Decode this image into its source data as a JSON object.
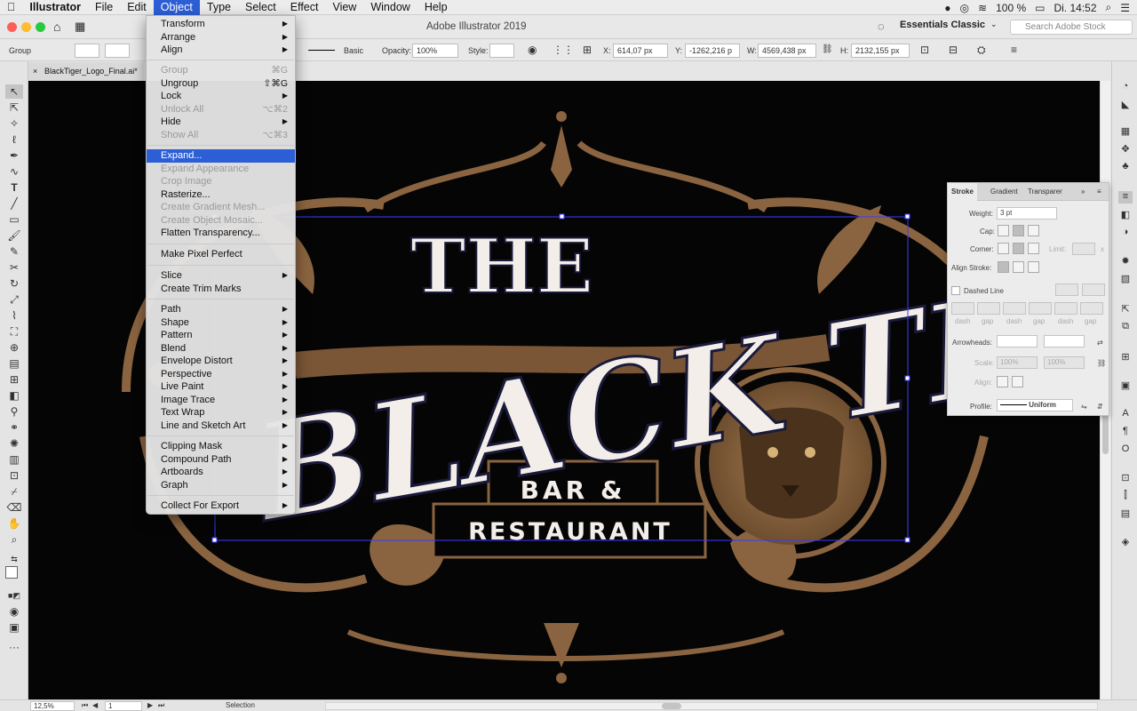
{
  "menubar": {
    "apple": "",
    "app_name": "Illustrator",
    "items": [
      "File",
      "Edit",
      "Object",
      "Type",
      "Select",
      "Effect",
      "View",
      "Window",
      "Help"
    ],
    "active": "Object",
    "right": {
      "battery": "100 %",
      "clock": "Di. 14:52"
    }
  },
  "window": {
    "title": "Adobe Illustrator 2019",
    "workspace": "Essentials Classic",
    "search_placeholder": "Search Adobe Stock",
    "doc_tab": "BlackTiger_Logo_Final.ai* @ 1"
  },
  "control_bar": {
    "selection_type": "Group",
    "stroke_style": "Basic",
    "opacity_label": "Opacity:",
    "opacity_value": "100%",
    "style_label": "Style:",
    "x_label": "X:",
    "x_value": "614,07 px",
    "y_label": "Y:",
    "y_value": "-1262,216 p",
    "w_label": "W:",
    "w_value": "4569,438 px",
    "h_label": "H:",
    "h_value": "2132,155 px"
  },
  "object_menu": {
    "transform": "Transform",
    "arrange": "Arrange",
    "align": "Align",
    "group": "Group",
    "group_sc": "⌘G",
    "ungroup": "Ungroup",
    "ungroup_sc": "⇧⌘G",
    "lock": "Lock",
    "unlock_all": "Unlock All",
    "unlock_sc": "⌥⌘2",
    "hide": "Hide",
    "show_all": "Show All",
    "show_sc": "⌥⌘3",
    "expand": "Expand...",
    "expand_appearance": "Expand Appearance",
    "crop_image": "Crop Image",
    "rasterize": "Rasterize...",
    "gradient_mesh": "Create Gradient Mesh...",
    "object_mosaic": "Create Object Mosaic...",
    "flatten": "Flatten Transparency...",
    "pixel_perfect": "Make Pixel Perfect",
    "slice": "Slice",
    "trim_marks": "Create Trim Marks",
    "path": "Path",
    "shape": "Shape",
    "pattern": "Pattern",
    "blend": "Blend",
    "envelope": "Envelope Distort",
    "perspective": "Perspective",
    "live_paint": "Live Paint",
    "image_trace": "Image Trace",
    "text_wrap": "Text Wrap",
    "line_sketch": "Line and Sketch Art",
    "clipping_mask": "Clipping Mask",
    "compound_path": "Compound Path",
    "artboards": "Artboards",
    "graph": "Graph",
    "collect_export": "Collect For Export"
  },
  "stroke_panel": {
    "tabs": [
      "Stroke",
      "Gradient",
      "Transparer"
    ],
    "weight_label": "Weight:",
    "weight_value": "3 pt",
    "cap_label": "Cap:",
    "corner_label": "Corner:",
    "limit_label": "Limit:",
    "limit_x": "x",
    "align_label": "Align Stroke:",
    "dashed_label": "Dashed Line",
    "dash_labels": [
      "dash",
      "gap",
      "dash",
      "gap",
      "dash",
      "gap"
    ],
    "arrowheads_label": "Arrowheads:",
    "scale_label": "Scale:",
    "scale_value": "100%",
    "align2_label": "Align:",
    "profile_label": "Profile:",
    "profile_value": "Uniform"
  },
  "artwork": {
    "line1": "THE",
    "line2": "BLACK TIGER",
    "line3": "BAR &",
    "line4": "RESTAURANT",
    "colors": {
      "gold": "#8a6440",
      "cream": "#f3eee9",
      "bg": "#050505",
      "selection": "#3a3aff"
    }
  },
  "status": {
    "zoom": "12,5%",
    "page": "1",
    "tool": "Selection"
  }
}
